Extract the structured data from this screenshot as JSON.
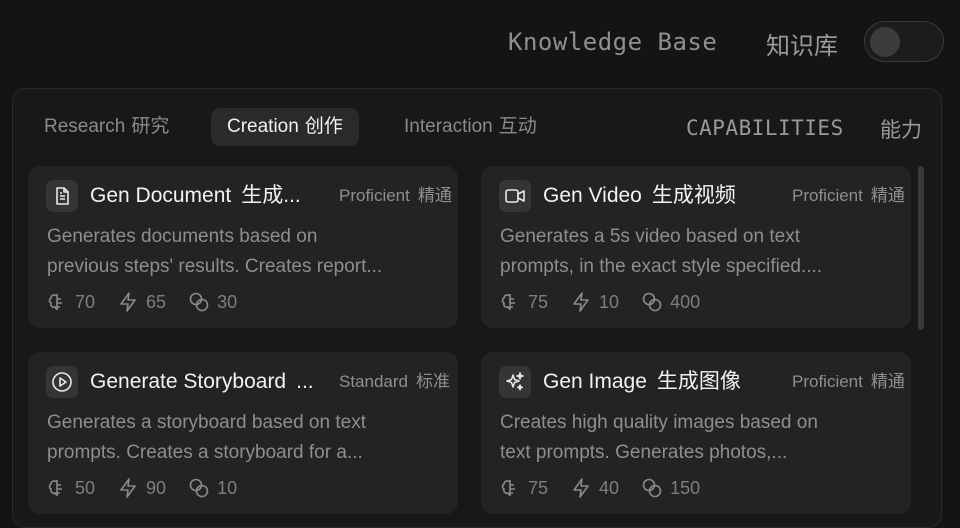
{
  "header": {
    "knowledge_base_label": "Knowledge Base",
    "knowledge_base_label_cn": "知识库",
    "knowledge_base_toggle_on": false
  },
  "tabs": [
    {
      "label": "Research",
      "label_cn": "研究",
      "active": false
    },
    {
      "label": "Creation",
      "label_cn": "创作",
      "active": true
    },
    {
      "label": "Interaction",
      "label_cn": "互动",
      "active": false
    }
  ],
  "capabilities_label": "CAPABILITIES",
  "capabilities_label_cn": "能力",
  "cards": [
    {
      "icon": "document-icon",
      "title": "Gen Document",
      "title_cn": "生成...",
      "level": "Proficient",
      "level_cn": "精通",
      "desc_line1": "Generates documents based on",
      "desc_line2": "previous steps' results. Creates report...",
      "stat1": "70",
      "stat2": "65",
      "stat3": "30"
    },
    {
      "icon": "video-icon",
      "title": "Gen Video",
      "title_cn": "生成视频",
      "level": "Proficient",
      "level_cn": "精通",
      "desc_line1": "Generates a 5s video based on text",
      "desc_line2": "prompts, in the exact style specified....",
      "stat1": "75",
      "stat2": "10",
      "stat3": "400"
    },
    {
      "icon": "play-circle-icon",
      "title": "Generate Storyboard",
      "title_cn": "...",
      "level": "Standard",
      "level_cn": "标准",
      "desc_line1": "Generates a storyboard based on text",
      "desc_line2": "prompts. Creates a storyboard for a...",
      "stat1": "50",
      "stat2": "90",
      "stat3": "10"
    },
    {
      "icon": "sparkles-icon",
      "title": "Gen Image",
      "title_cn": "生成图像",
      "level": "Proficient",
      "level_cn": "精通",
      "desc_line1": "Creates high quality images based on",
      "desc_line2": "text prompts. Generates photos,...",
      "stat1": "75",
      "stat2": "40",
      "stat3": "150"
    }
  ]
}
